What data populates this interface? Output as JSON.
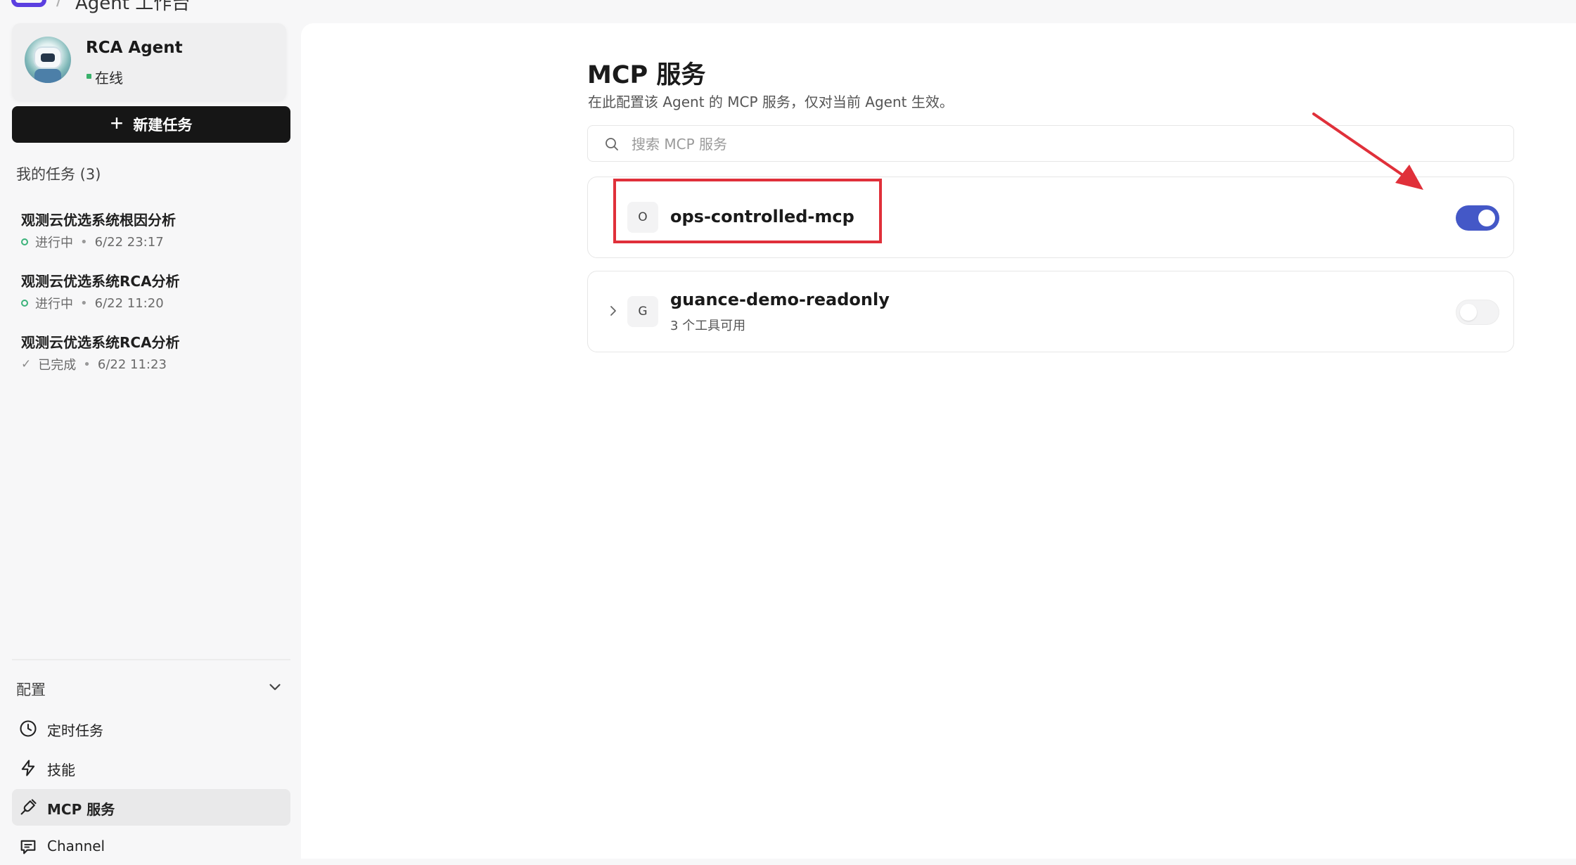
{
  "breadcrumb": {
    "separator": "/",
    "current": "Agent 工作台"
  },
  "agent": {
    "name": "RCA Agent",
    "status": "在线"
  },
  "new_task": {
    "label": "新建任务"
  },
  "tasks": {
    "heading": "我的任务 (3)",
    "items": [
      {
        "title": "观测云优选系统根因分析",
        "status": "进行中",
        "time": "6/22 23:17"
      },
      {
        "title": "观测云优选系统RCA分析",
        "status": "进行中",
        "time": "6/22 11:20"
      },
      {
        "title": "观测云优选系统RCA分析",
        "status": "已完成",
        "time": "6/22 11:23"
      }
    ]
  },
  "config": {
    "heading": "配置",
    "items": [
      {
        "label": "定时任务",
        "icon": "clock-icon"
      },
      {
        "label": "技能",
        "icon": "lightning-icon"
      },
      {
        "label": "MCP 服务",
        "icon": "plug-icon",
        "active": true
      },
      {
        "label": "Channel",
        "icon": "message-icon"
      }
    ]
  },
  "page": {
    "title": "MCP 服务",
    "subtitle": "在此配置该 Agent 的 MCP 服务，仅对当前 Agent 生效。"
  },
  "search": {
    "placeholder": "搜索 MCP 服务",
    "value": ""
  },
  "services": [
    {
      "letter": "O",
      "name": "ops-controlled-mcp",
      "description": "",
      "enabled": true
    },
    {
      "letter": "G",
      "name": "guance-demo-readonly",
      "description": "3 个工具可用",
      "enabled": false
    }
  ],
  "colors": {
    "accent": "#4458c7",
    "brand": "#5b3fe0",
    "status_running": "#3bb27a",
    "status_online": "#39b16b",
    "annotation": "#e0303a"
  }
}
